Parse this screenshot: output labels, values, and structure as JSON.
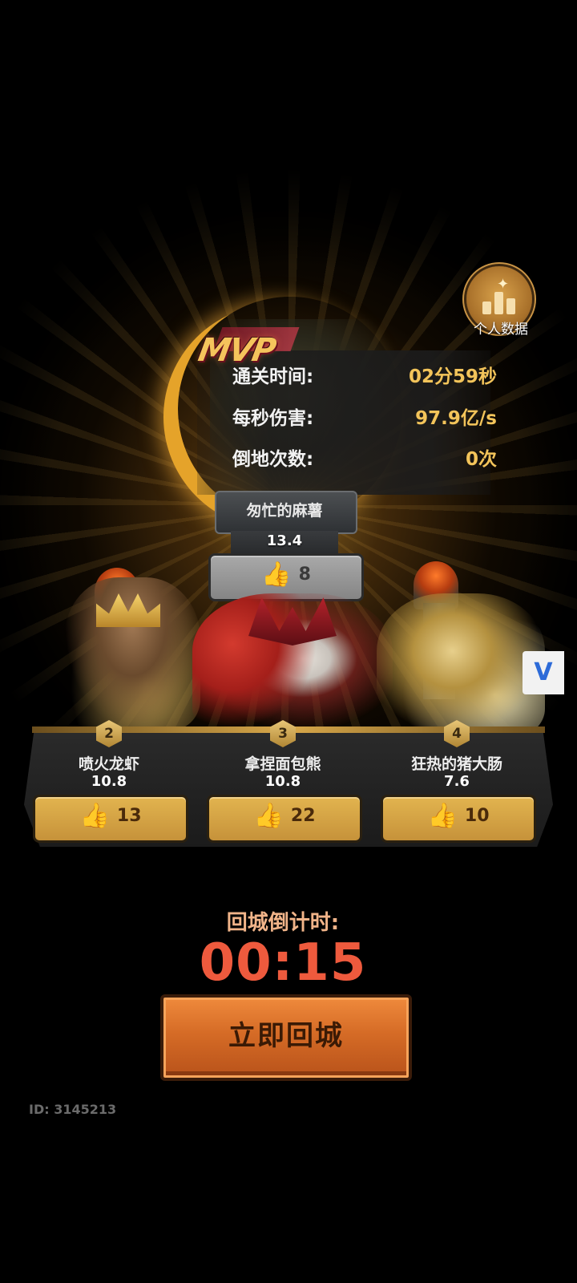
{
  "personal_data": {
    "label": "个人数据"
  },
  "mvp": {
    "logo_text": "MVP",
    "stats": [
      {
        "label": "通关时间:",
        "value": "02分59秒"
      },
      {
        "label": "每秒伤害:",
        "value": "97.9亿/s"
      },
      {
        "label": "倒地次数:",
        "value": "0次"
      }
    ],
    "player": {
      "name": "匆忙的麻薯",
      "score": "13.4",
      "likes": "8"
    }
  },
  "players": [
    {
      "rank": "2",
      "name": "喷火龙虾",
      "score": "10.8",
      "likes": "13"
    },
    {
      "rank": "3",
      "name": "拿捏面包熊",
      "score": "10.8",
      "likes": "22"
    },
    {
      "rank": "4",
      "name": "狂热的猪大肠",
      "score": "7.6",
      "likes": "10"
    }
  ],
  "countdown": {
    "label": "回城倒计时:",
    "time": "00:15"
  },
  "return_button": {
    "label": "立即回城"
  },
  "footer": {
    "id": "ID: 3145213"
  },
  "icons": {
    "like": "thumbs-up-icon",
    "stats": "bar-chart-icon",
    "side": "v-logo-icon"
  },
  "colors": {
    "gold": "#f3c45a",
    "countdown": "#ee5a3d",
    "button": "#d56b26"
  }
}
